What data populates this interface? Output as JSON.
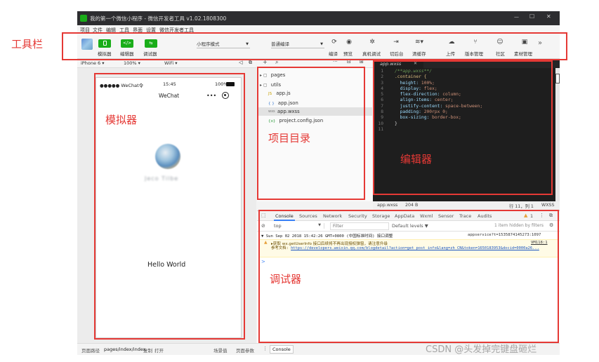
{
  "titlebar": {
    "title": "我的第一个微信小程序 - 微信开发者工具 v1.02.1808300",
    "minimize": "—",
    "maximize": "☐",
    "close": "✕"
  },
  "menu": [
    "项目",
    "文件",
    "编辑",
    "工具",
    "界面",
    "设置",
    "微信开发者工具"
  ],
  "annotations": {
    "toolbar": "工具栏",
    "simulator": "模拟器",
    "project": "项目目录",
    "editor": "编辑器",
    "debugger": "调试器"
  },
  "toolbar": {
    "simulator_label": "模拟器",
    "editor_label": "编辑器",
    "debugger_label": "调试器",
    "editor_btn_glyph": "</>",
    "debugger_btn_glyph": "⇆",
    "mode_select": "小程序模式",
    "compile_select": "普通编译",
    "compile": "编译",
    "preview": "预览",
    "remote_debug": "真机调试",
    "background": "切后台",
    "clear_cache": "清缓存",
    "upload": "上传",
    "version": "版本管理",
    "community": "社区",
    "material": "素材管理",
    "more": "»"
  },
  "device_bar": {
    "device": "iPhone 6",
    "zoom": "100%",
    "network": "WiFi"
  },
  "phone": {
    "carrier": "●●●●● WeChat令",
    "time": "15:45",
    "battery": "100%",
    "nav_title": "WeChat",
    "dots": "•••",
    "blurred_name": "Jeco Tilbe",
    "hello": "Hello World"
  },
  "project_toolbar": {
    "add": "+",
    "search": "🔍",
    "more": "···",
    "collapse": "⊟",
    "split": "⊞"
  },
  "file_tree": [
    {
      "icon": "▸ ▢",
      "name": "pages",
      "color": "#333"
    },
    {
      "icon": "▸ ▢",
      "name": "utils",
      "color": "#333"
    },
    {
      "icon": "JS",
      "name": "app.js",
      "color": "#c8a000"
    },
    {
      "icon": "{ }",
      "name": "app.json",
      "color": "#3a7ad0"
    },
    {
      "icon": "wxs",
      "name": "app.wxss",
      "color": "#777"
    },
    {
      "icon": "{o}",
      "name": "project.config.json",
      "color": "#2e9d3d"
    }
  ],
  "editor": {
    "tab": "app.wxss",
    "tab_close": "✕",
    "lines": [
      "/**app.wxss**/",
      ".container {",
      "  height: 100%;",
      "  display: flex;",
      "  flex-direction: column;",
      "  align-items: center;",
      "  justify-content: space-between;",
      "  padding: 200rpx 0;",
      "  box-sizing: border-box;",
      "}",
      ""
    ],
    "status_file": "app.wxss",
    "status_size": "204 B",
    "status_pos": "行 11，列 1",
    "status_lang": "WXSS"
  },
  "devtools": {
    "tabs": [
      "Console",
      "Sources",
      "Network",
      "Security",
      "Storage",
      "AppData",
      "Wxml",
      "Sensor",
      "Trace",
      "Audits"
    ],
    "warn_count": "1",
    "top_select": "top",
    "filter_placeholder": "Filter",
    "levels": "Default levels ▼",
    "hidden": "1 item hidden by filters",
    "log_header": "Sun Sep 02 2018 15:42:26 GMT+0800 (中国标准时间) 接口调整",
    "log_header_src": "appservice?t=1535874145273:1097",
    "warn_line1": "▸获取 wx.getUserInfo 接口后续将不再出现授权弹窗，请注意升级",
    "warn_src": "VM118:1",
    "warn_line2_prefix": "参考文档: ",
    "warn_link": "https://developers.weixin.qq.com/blogdetail?action=get_post_info&lang=zh_CN&token=1650183953&docid=0000a26...",
    "prompt": ">"
  },
  "statusbar": {
    "path_label": "页面路径",
    "path": "pages/index/index",
    "copy": "复制",
    "open": "打开",
    "scene": "场景值",
    "params": "页面参数",
    "console": "Console"
  },
  "watermark": "CSDN @头发掉完键盘砸烂"
}
